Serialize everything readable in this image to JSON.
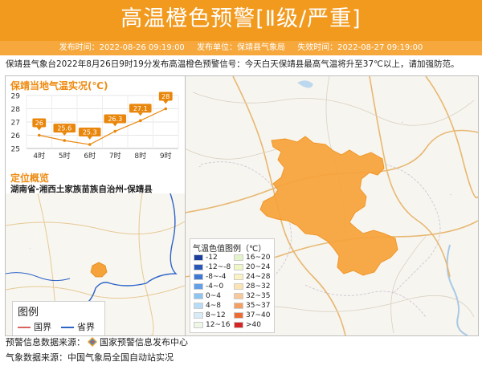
{
  "header": {
    "title": "高温橙色预警[Ⅱ级/严重]",
    "publish_time": "发布时间：2022-08-26 09:19:00",
    "publisher": "发布单位：保靖县气象局",
    "expire_time": "失效时间：2022-08-27 09:19:00"
  },
  "notice": "保靖县气象台2022年8月26日9时19分发布高温橙色预警信号：今天白天保靖县最高气温将升至37℃以上，请加强防范。",
  "temp_chart_title": "保靖当地气温实况(℃)",
  "location": {
    "title": "定位概览",
    "text": "湖南省-湘西土家族苗族自治州-保靖县"
  },
  "boundary_legend": {
    "title": "图例",
    "national_border": "国界",
    "provincial_border": "省界",
    "national_color": "#d9645f",
    "provincial_color": "#2d64c8"
  },
  "heat_legend": {
    "title": "气温色值图例（℃）",
    "items": [
      {
        "label": "-12",
        "color": "#1c3f9e"
      },
      {
        "label": "16~20",
        "color": "#e3f3cc"
      },
      {
        "label": "-12~-8",
        "color": "#2857b8"
      },
      {
        "label": "20~24",
        "color": "#f0f7c4"
      },
      {
        "label": "-8~-4",
        "color": "#3d78d2"
      },
      {
        "label": "24~28",
        "color": "#fbf2c4"
      },
      {
        "label": "-4~0",
        "color": "#63a0e6"
      },
      {
        "label": "28~32",
        "color": "#fbe3b4"
      },
      {
        "label": "0~4",
        "color": "#8ec4f0"
      },
      {
        "label": "32~35",
        "color": "#f9c89a"
      },
      {
        "label": "4~8",
        "color": "#b8dcf5"
      },
      {
        "label": "35~37",
        "color": "#f4a064"
      },
      {
        "label": "8~12",
        "color": "#d8ecf8"
      },
      {
        "label": "37~40",
        "color": "#ec6a34"
      },
      {
        "label": "12~16",
        "color": "#eef7e6"
      },
      {
        "label": ">40",
        "color": "#d42424"
      }
    ]
  },
  "footer": {
    "source_label": "预警信息数据来源：",
    "source_name": "国家预警信息发布中心",
    "weather_source": "气象数据来源：中国气象局全国自动站实况"
  },
  "colors": {
    "banner": "#f29a1e",
    "meta_bar": "#f6a83d",
    "warning_area": "#f6a23a",
    "accent_text": "#ee8a10",
    "chart_line": "#e9870d"
  },
  "chart_data": {
    "type": "line",
    "title": "保靖当地气温实况(℃)",
    "categories": [
      "4时",
      "5时",
      "6时",
      "7时",
      "8时",
      "9时"
    ],
    "values": [
      26,
      25.6,
      25.3,
      26.3,
      27.1,
      28
    ],
    "ylim": [
      25,
      29
    ],
    "yticks": [
      25,
      26,
      27,
      28,
      29
    ],
    "grid": true
  }
}
